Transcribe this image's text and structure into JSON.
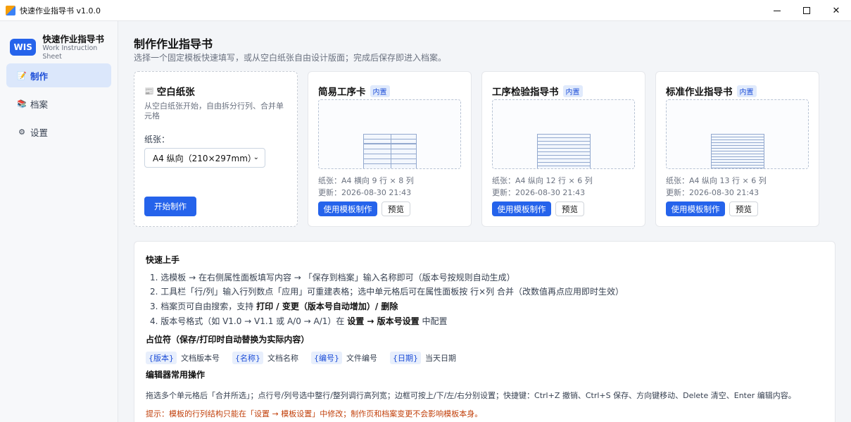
{
  "window": {
    "title": "快速作业指导书 v1.0.0",
    "minimize": "—",
    "maximize": "☐",
    "close": "✕"
  },
  "brand": {
    "badge": "WIS",
    "title": "快速作业指导书",
    "subtitle": "Work Instruction Sheet"
  },
  "nav": [
    {
      "label": "制作",
      "icon": "pencil-icon",
      "glyph": "📝",
      "active": true
    },
    {
      "label": "档案",
      "icon": "books-icon",
      "glyph": "📚",
      "active": false
    },
    {
      "label": "设置",
      "icon": "gear-icon",
      "glyph": "⚙",
      "active": false
    }
  ],
  "page": {
    "title": "制作作业指导书",
    "subtitle": "选择一个固定模板快速填写，或从空白纸张自由设计版面；完成后保存即进入档案。"
  },
  "blank_card": {
    "icon": "📰",
    "title": "空白纸张",
    "desc": "从空白纸张开始，自由拆分行列、合并单元格",
    "paper_label": "纸张：",
    "paper_value": "A4 纵向（210×297mm）",
    "start_button": "开始制作"
  },
  "templates": [
    {
      "title": "简易工序卡",
      "tag": "内置",
      "paper": "纸张：A4 横向    9 行 × 8 列",
      "updated": "更新：2026-08-30 21:43",
      "use_button": "使用模板制作",
      "preview_button": "预览"
    },
    {
      "title": "工序检验指导书",
      "tag": "内置",
      "paper": "纸张：A4 纵向    12 行 × 6 列",
      "updated": "更新：2026-08-30 21:43",
      "use_button": "使用模板制作",
      "preview_button": "预览"
    },
    {
      "title": "标准作业指导书",
      "tag": "内置",
      "paper": "纸张：A4 纵向    13 行 × 6 列",
      "updated": "更新：2026-08-30 21:43",
      "use_button": "使用模板制作",
      "preview_button": "预览"
    }
  ],
  "quick": {
    "title": "快速上手",
    "steps": [
      "1. 选模板 → 在右侧属性面板填写内容 → 「保存到档案」输入名称即可（版本号按规则自动生成）",
      "2. 工具栏「行/列」输入行列数点「应用」可重建表格；选中单元格后可在属性面板按 行×列 合并（改数值再点应用即时生效）"
    ],
    "step3_a": "3. 档案页可自由搜索，支持 ",
    "step3_b": "打印 / 变更（版本号自动增加）/ 删除",
    "step4_a": "4. 版本号格式（如 V1.0 → V1.1 或 A/0 → A/1）在 ",
    "step4_b": "设置 → 版本号设置",
    "step4_c": " 中配置",
    "placeholder_title": "占位符（保存/打印时自动替换为实际内容）",
    "placeholders": [
      {
        "code": "{版本}",
        "desc": "文档版本号"
      },
      {
        "code": "{名称}",
        "desc": "文档名称"
      },
      {
        "code": "{编号}",
        "desc": "文件编号"
      },
      {
        "code": "{日期}",
        "desc": "当天日期"
      }
    ],
    "ops_title": "编辑器常用操作",
    "ops": "拖选多个单元格后「合并所选」；点行号/列号选中整行/整列调行高列宽；边框可按上/下/左/右分别设置；快捷键：Ctrl+Z 撤销、Ctrl+S 保存、方向键移动、Delete 清空、Enter 编辑内容。",
    "tip": "提示：模板的行列结构只能在「设置 → 模板设置」中修改；制作页和档案变更不会影响模板本身。"
  }
}
